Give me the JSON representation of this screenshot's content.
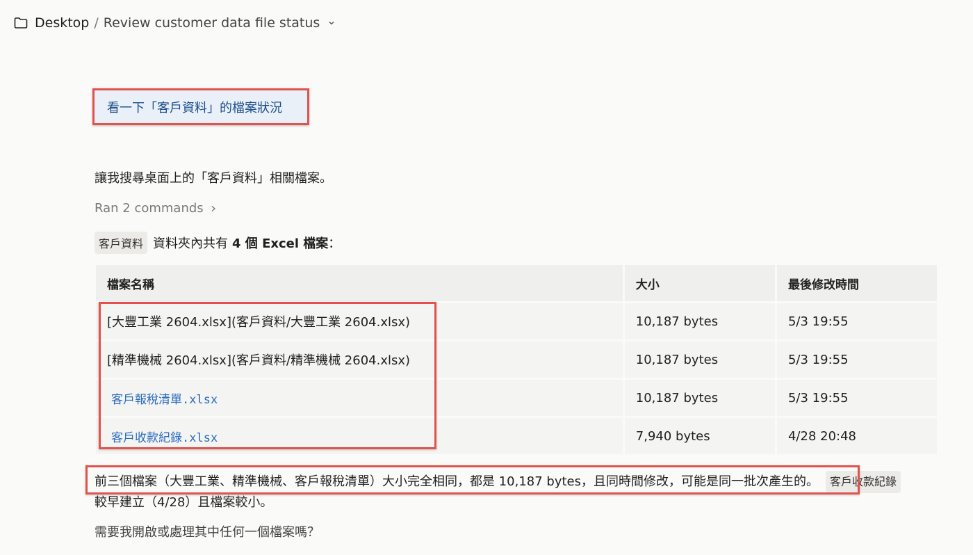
{
  "breadcrumb": {
    "root": "Desktop",
    "separator": "/",
    "page": "Review customer data file status"
  },
  "user_message": "看一下「客戶資料」的檔案狀況",
  "assistant": {
    "intro": "讓我搜尋桌面上的「客戶資料」相關檔案。",
    "ran_commands": "Ran 2 commands",
    "summary_chip": "客戶資料",
    "summary_pre": "資料夾內共有",
    "summary_bold": "4 個 Excel 檔案",
    "summary_post": "：",
    "table": {
      "headers": [
        "檔案名稱",
        "大小",
        "最後修改時間"
      ],
      "rows": [
        {
          "name": "[大豐工業 2604.xlsx](客戶資料/大豐工業 2604.xlsx)",
          "size": "10,187 bytes",
          "modified": "5/3 19:55"
        },
        {
          "name": "[精準機械 2604.xlsx](客戶資料/精準機械 2604.xlsx)",
          "size": "10,187 bytes",
          "modified": "5/3 19:55"
        },
        {
          "name": "客戶報稅清單.xlsx",
          "size": "10,187 bytes",
          "modified": "5/3 19:55"
        },
        {
          "name": "客戶收款紀錄.xlsx",
          "size": "7,940 bytes",
          "modified": "4/28 20:48"
        }
      ]
    },
    "paragraph_line1": "前三個檔案（大豐工業、精準機械、客戶報稅清單）大小完全相同，都是 10,187 bytes，且同時間修改，可能是同一批次產生的。",
    "paragraph_chip": "客戶收款紀錄",
    "paragraph_line2": "較早建立（4/28）且檔案較小。",
    "question": "需要我開啟或處理其中任何一個檔案嗎？"
  },
  "colors": {
    "highlight_border": "#e2534d",
    "link": "#2a6bbf",
    "user_bubble": "#e9f0f8"
  }
}
